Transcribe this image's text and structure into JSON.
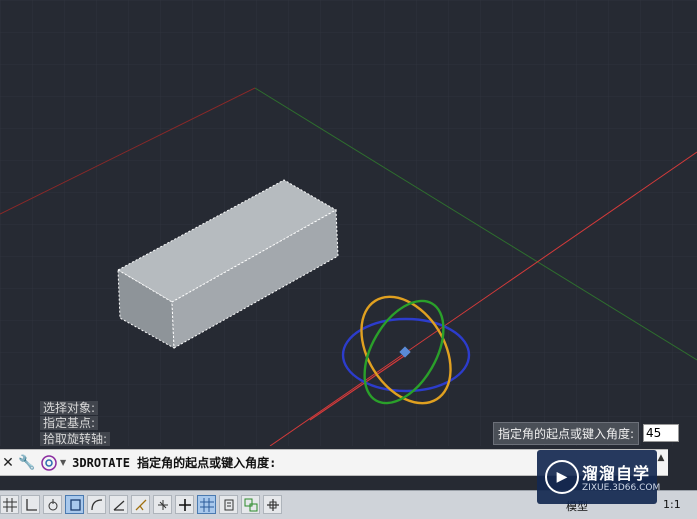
{
  "viewport": {
    "history": [
      "选择对象:",
      "指定基点:",
      "拾取旋转轴:"
    ],
    "dynamic_prompt": {
      "label": "指定角的起点或键入角度:",
      "value": "45"
    }
  },
  "command_line": {
    "close_icon": "close-icon",
    "settings_icon": "wrench-icon",
    "command_icon": "command-icon",
    "text": "3DROTATE 指定角的起点或键入角度:"
  },
  "status_bar": {
    "buttons": [
      "grid-icon",
      "snap-icon",
      "infer-icon",
      "ortho-icon",
      "polar-icon",
      "osnap-icon",
      "otrack-icon",
      "ducs-icon",
      "dyn-icon",
      "lineweight-icon",
      "transparency-icon",
      "selection-cycling-icon",
      "3dosnap-icon"
    ],
    "model_label": "模型",
    "scale_label": "1:1"
  },
  "watermark": {
    "title": "溜溜自学",
    "subtitle": "ZIXUE.3D66.COM"
  },
  "colors": {
    "background": "#262a33",
    "x_axis": "#d43a3a",
    "y_axis": "#3c8a3c",
    "gizmo_blue": "#2c3ccc",
    "gizmo_orange": "#e0a020",
    "gizmo_green": "#2aa02a"
  }
}
